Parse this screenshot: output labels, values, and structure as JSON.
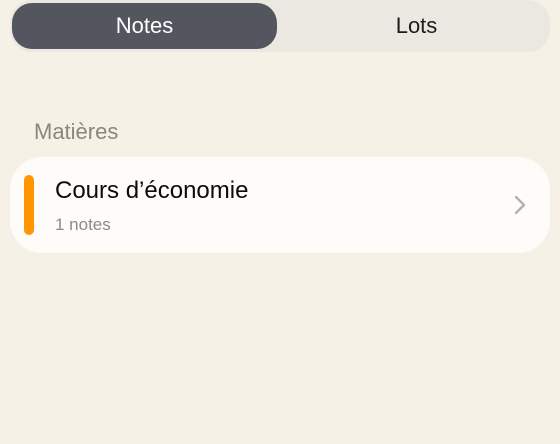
{
  "tabs": [
    {
      "label": "Notes",
      "selected": true
    },
    {
      "label": "Lots",
      "selected": false
    }
  ],
  "section": {
    "title": "Matières"
  },
  "subjects": [
    {
      "title": "Cours d’économie",
      "subtitle": "1 notes",
      "color": "#ff9500"
    }
  ],
  "colors": {
    "background": "#f6f1e6",
    "segment_active": "#54565f",
    "accent": "#ff9500"
  },
  "icons": {
    "row_chevron": "chevron-right-icon"
  }
}
